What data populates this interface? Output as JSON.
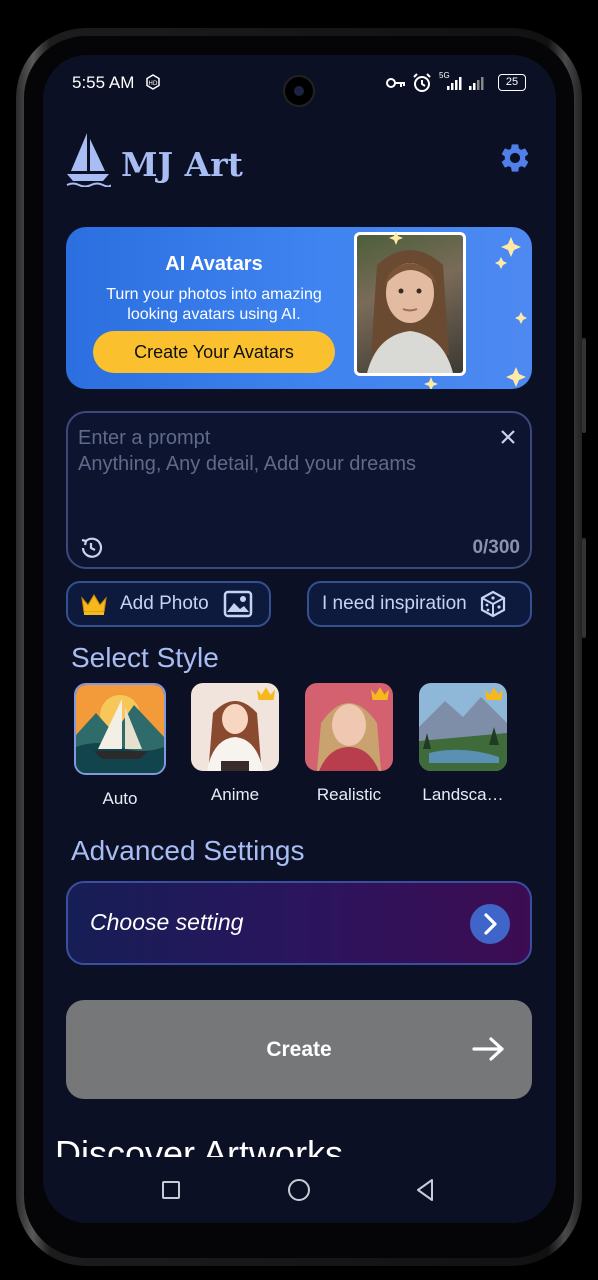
{
  "status_bar": {
    "time": "5:55 AM",
    "battery": "25",
    "network": "5G"
  },
  "header": {
    "app_title": "MJ Art"
  },
  "banner": {
    "title": "AI Avatars",
    "subtitle_line1": "Turn your photos into amazing",
    "subtitle_line2": "looking avatars using AI.",
    "button_label": "Create Your Avatars"
  },
  "prompt": {
    "placeholder_line1": "Enter a prompt",
    "placeholder_line2": "Anything, Any detail, Add your dreams",
    "counter": "0/300"
  },
  "actions": {
    "add_photo": "Add Photo",
    "inspiration": "I need inspiration"
  },
  "styles": {
    "title": "Select Style",
    "items": [
      {
        "label": "Auto",
        "selected": true,
        "premium": false
      },
      {
        "label": "Anime",
        "selected": false,
        "premium": true
      },
      {
        "label": "Realistic",
        "selected": false,
        "premium": true
      },
      {
        "label": "Landsca…",
        "selected": false,
        "premium": true
      }
    ]
  },
  "advanced": {
    "title": "Advanced Settings",
    "choose_label": "Choose setting"
  },
  "create": {
    "label": "Create"
  },
  "discover": {
    "title": "Discover Artworks"
  },
  "colors": {
    "accent": "#a9bdf5",
    "banner_button": "#fbc02d",
    "background": "#0b1024"
  }
}
